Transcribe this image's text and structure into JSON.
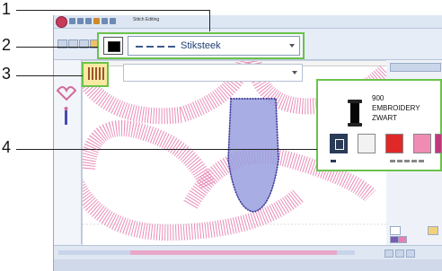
{
  "callouts": {
    "one": "1",
    "two": "2",
    "three": "3",
    "four": "4"
  },
  "window": {
    "title": "Stitch Editing"
  },
  "line_sort": {
    "label": "Stiksteek"
  },
  "thread": {
    "number": "900",
    "name_line1": "EMBROIDERY",
    "name_line2": "ZWART",
    "swatches": [
      "#2a3b55",
      "#f2f2f2",
      "#e02828",
      "#f08cb4",
      "#c2367a"
    ]
  },
  "colors": {
    "highlight": "#6ac24a",
    "pink_stitch": "#e77fb0",
    "blue_stitch": "#3a3a9a"
  }
}
